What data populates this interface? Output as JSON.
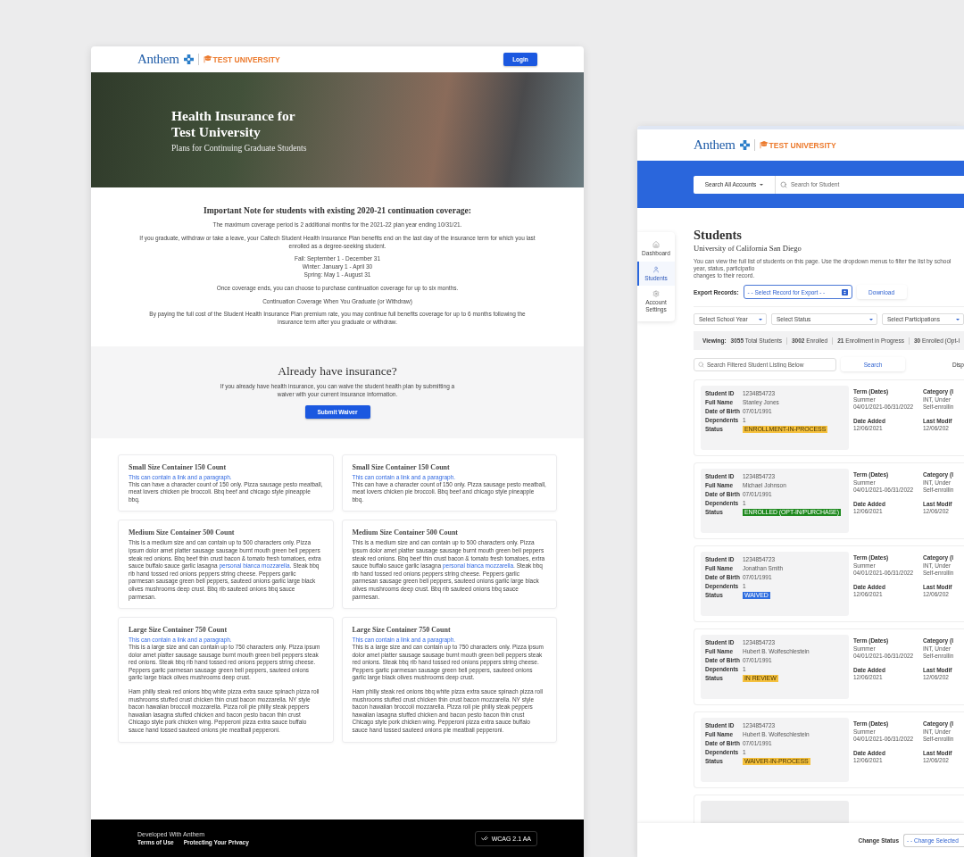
{
  "landing": {
    "header": {
      "brand": "Anthem",
      "partner": "TEST UNIVERSITY",
      "login": "Login"
    },
    "hero": {
      "title_lines": [
        "Health Insurance for",
        "Test University"
      ],
      "subtitle": "Plans for Continuing Graduate Students"
    },
    "note": {
      "heading": "Important Note for students with existing 2020-21 continuation coverage:",
      "blocks": [
        {
          "kind": "paragraph",
          "lines": [
            "The maximum coverage period is 2 additional months for the 2021-22 plan year ending 10/31/21."
          ]
        },
        {
          "kind": "paragraph",
          "lines": [
            "If you graduate, withdraw or take a leave, your Caltech Student Health Insurance Plan benefits end on the last day of the insurance term for which you last",
            "enrolled as a degree-seeking student."
          ]
        },
        {
          "kind": "paragraph",
          "lines": [
            "Fall: September 1 - December 31",
            "Winter: January 1 - April 30",
            "Spring: May 1 - August 31"
          ]
        },
        {
          "kind": "paragraph",
          "lines": [
            "Once coverage ends, you can choose to purchase continuation coverage for up to six months."
          ]
        },
        {
          "kind": "paragraph",
          "lines": [
            "Continuation Coverage When You Graduate (or Withdraw)"
          ]
        },
        {
          "kind": "paragraph",
          "lines": [
            "By paying the full cost of the Student Health Insurance Plan premium rate, you may continue full benefits coverage for up to 6 months following the",
            "insurance term after you graduate or withdraw."
          ]
        }
      ]
    },
    "waiver": {
      "heading": "Already have insurance?",
      "lines": [
        "If you already have health insurance, you can waive the student health plan by submitting a",
        "waiver with your current insurance information."
      ],
      "button": "Submit Waiver"
    },
    "cards": [
      {
        "title": "Small Size Container 150 Count",
        "link": "This can contain a link and a paragraph.",
        "paragraphs": [
          [
            {
              "kind": "text",
              "text": "This can have a character count of 150 only. Pizza sausage pesto meatball, meat lovers chicken pie broccoli. Bbq beef and chicago style pineapple bbq."
            }
          ]
        ]
      },
      {
        "title": "Small Size Container 150 Count",
        "link": "This can contain a link and a paragraph.",
        "paragraphs": [
          [
            {
              "kind": "text",
              "text": "This can have a character count of 150 only. Pizza sausage pesto meatball, meat lovers chicken pie broccoli. Bbq beef and chicago style pineapple bbq."
            }
          ]
        ]
      },
      {
        "title": "Medium Size Container 500 Count",
        "paragraphs": [
          [
            {
              "kind": "text",
              "text": "This is a medium size and can contain up to 500 characters only. Pizza ipsum dolor amet platter sausage sausage burnt mouth green bell peppers steak red onions. Bbq beef thin crust bacon & tomato fresh tomatoes, extra sauce buffalo sauce garlic lasagna "
            },
            {
              "kind": "link",
              "text": "personal bianca mozzarella"
            },
            {
              "kind": "text",
              "text": ". Steak bbq rib hand tossed red onions peppers string cheese. Peppers garlic parmesan sausage green bell peppers, sauteed onions garlic large black olives mushrooms deep crust. Bbq rib sauteed onions bbq sauce parmesan."
            }
          ]
        ]
      },
      {
        "title": "Medium Size Container 500 Count",
        "paragraphs": [
          [
            {
              "kind": "text",
              "text": "This is a medium size and can contain up to 500 characters only. Pizza ipsum dolor amet platter sausage sausage burnt mouth green bell peppers steak red onions. Bbq beef thin crust bacon & tomato fresh tomatoes, extra sauce buffalo sauce garlic lasagna "
            },
            {
              "kind": "link",
              "text": "personal bianca mozzarella"
            },
            {
              "kind": "text",
              "text": ". Steak bbq rib hand tossed red onions peppers string cheese. Peppers garlic parmesan sausage green bell peppers, sauteed onions garlic large black olives mushrooms deep crust. Bbq rib sauteed onions bbq sauce parmesan."
            }
          ]
        ]
      },
      {
        "title": "Large Size Container 750 Count",
        "link": "This can contain a link and a paragraph.",
        "paragraphs": [
          [
            {
              "kind": "text",
              "text": "This is a large size and can contain up to 750 characters only. Pizza ipsum dolor amet platter sausage sausage burnt mouth green bell peppers steak red onions. Steak bbq rib hand tossed red onions peppers string cheese. Peppers garlic parmesan sausage green bell peppers, sauteed onions garlic large black olives mushrooms deep crust."
            }
          ],
          [
            {
              "kind": "text",
              "text": "Ham philly steak red onions bbq white pizza extra sauce spinach pizza roll mushrooms stuffed crust chicken thin crust bacon mozzarella. NY style bacon hawaiian broccoli mozzarella. Pizza roll pie philly steak peppers hawaiian lasagna stuffed chicken and bacon pesto bacon thin crust Chicago style pork chicken wing. Pepperoni pizza extra sauce buffalo sauce hand tossed sauteed onions pie meatball pepperoni."
            }
          ]
        ]
      },
      {
        "title": "Large Size Container 750 Count",
        "link": "This can contain a link and a paragraph.",
        "paragraphs": [
          [
            {
              "kind": "text",
              "text": "This is a large size and can contain up to 750 characters only. Pizza ipsum dolor amet platter sausage sausage burnt mouth green bell peppers steak red onions. Steak bbq rib hand tossed red onions peppers string cheese. Peppers garlic parmesan sausage green bell peppers, sauteed onions garlic large black olives mushrooms deep crust."
            }
          ],
          [
            {
              "kind": "text",
              "text": "Ham philly steak red onions bbq white pizza extra sauce spinach pizza roll mushrooms stuffed crust chicken thin crust bacon mozzarella. NY style bacon hawaiian broccoli mozzarella. Pizza roll pie philly steak peppers hawaiian lasagna stuffed chicken and bacon pesto bacon thin crust Chicago style pork chicken wing. Pepperoni pizza extra sauce buffalo sauce hand tossed sauteed onions pie meatball pepperoni."
            }
          ]
        ]
      }
    ],
    "footer": {
      "credit": "Developed With Anthem",
      "links": [
        "Terms of Use",
        "Protecting Your Privacy"
      ],
      "badge": "WCAG 2.1 AA"
    }
  },
  "portal": {
    "header": {
      "brand": "Anthem",
      "partner": "TEST UNIVERSITY"
    },
    "search": {
      "scope": "Search All Accounts",
      "placeholder": "Search for Student"
    },
    "sidebar": [
      {
        "label": "Dashboard",
        "kind": "home",
        "selected": false
      },
      {
        "label": "Students",
        "kind": "person",
        "selected": true
      },
      {
        "label": "Account Settings",
        "kind": "gear",
        "selected": false
      }
    ],
    "title": "Students",
    "subtitle": "University of California San Diego",
    "description": [
      "You can view the full list of students on this page. Use the dropdown menus to filter the list by school year, status, participatio",
      "changes to their record."
    ],
    "export": {
      "label": "Export Records:",
      "select": "- - Select Record for Export - -",
      "button": "Download"
    },
    "filters": [
      "Select School Year",
      "Select Status",
      "Select Participations"
    ],
    "stats": {
      "label": "Viewing:",
      "items": [
        {
          "count": "3055",
          "label": "Total Students"
        },
        {
          "count": "3002",
          "label": "Enrolled"
        },
        {
          "count": "21",
          "label": "Enrollment in Progress"
        },
        {
          "count": "30",
          "label": "Enrolled (Opt-I"
        }
      ]
    },
    "listing_search": {
      "placeholder": "Search Filtered Student Listing Below",
      "button": "Search",
      "cut_label": "Disp"
    },
    "records": [
      {
        "details": [
          {
            "label": "Student ID",
            "value": "1234854723"
          },
          {
            "label": "Full Name",
            "value": "Stanley Jones"
          },
          {
            "label": "Date of Birth",
            "value": "07/01/1991"
          },
          {
            "label": "Dependents",
            "value": "1"
          }
        ],
        "status": {
          "label": "Status",
          "value": "ENROLLMENT-IN-PROCESS",
          "color": "#f5c13e"
        },
        "term": {
          "label": "Term (Dates)",
          "season": "Summer",
          "dates": "04/01/2021-06/31/2022"
        },
        "added": {
          "label": "Date Added",
          "value": "12/06/2021"
        },
        "category": {
          "label": "Category (I",
          "lines": [
            "INT, Under",
            "Self-enrollin"
          ]
        },
        "modified": {
          "label": "Last Modif",
          "value": "12/06/202"
        }
      },
      {
        "details": [
          {
            "label": "Student ID",
            "value": "1234854723"
          },
          {
            "label": "Full Name",
            "value": "Michael Johnson"
          },
          {
            "label": "Date of Birth",
            "value": "07/01/1991"
          },
          {
            "label": "Dependents",
            "value": "1"
          }
        ],
        "status": {
          "label": "Status",
          "value": "ENROLLED (OPT-IN/PURCHASE)",
          "color": "#1f8a1f"
        },
        "term": {
          "label": "Term (Dates)",
          "season": "Summer",
          "dates": "04/01/2021-06/31/2022"
        },
        "added": {
          "label": "Date Added",
          "value": "12/06/2021"
        },
        "category": {
          "label": "Category (I",
          "lines": [
            "INT, Under",
            "Self-enrollin"
          ]
        },
        "modified": {
          "label": "Last Modif",
          "value": "12/06/202"
        }
      },
      {
        "details": [
          {
            "label": "Student ID",
            "value": "1234854723"
          },
          {
            "label": "Full Name",
            "value": "Jonathan Smith"
          },
          {
            "label": "Date of Birth",
            "value": "07/01/1991"
          },
          {
            "label": "Dependents",
            "value": "1"
          }
        ],
        "status": {
          "label": "Status",
          "value": "WAIVED",
          "color": "#2f6ee0"
        },
        "term": {
          "label": "Term (Dates)",
          "season": "Summer",
          "dates": "04/01/2021-06/31/2022"
        },
        "added": {
          "label": "Date Added",
          "value": "12/06/2021"
        },
        "category": {
          "label": "Category (I",
          "lines": [
            "INT, Under",
            "Self-enrollin"
          ]
        },
        "modified": {
          "label": "Last Modif",
          "value": "12/06/202"
        }
      },
      {
        "details": [
          {
            "label": "Student ID",
            "value": "1234854723"
          },
          {
            "label": "Full Name",
            "value": "Hubert B. Wolfeschlestein"
          },
          {
            "label": "Date of Birth",
            "value": "07/01/1991"
          },
          {
            "label": "Dependents",
            "value": "1"
          }
        ],
        "status": {
          "label": "Status",
          "value": "IN REVIEW",
          "color": "#f5c13e"
        },
        "term": {
          "label": "Term (Dates)",
          "season": "Summer",
          "dates": "04/01/2021-06/31/2022"
        },
        "added": {
          "label": "Date Added",
          "value": "12/06/2021"
        },
        "category": {
          "label": "Category (I",
          "lines": [
            "INT, Under",
            "Self-enrollin"
          ]
        },
        "modified": {
          "label": "Last Modif",
          "value": "12/06/202"
        }
      },
      {
        "details": [
          {
            "label": "Student ID",
            "value": "1234854723"
          },
          {
            "label": "Full Name",
            "value": "Hubert B. Wolfeschlestein"
          },
          {
            "label": "Date of Birth",
            "value": "07/01/1991"
          },
          {
            "label": "Dependents",
            "value": "1"
          }
        ],
        "status": {
          "label": "Status",
          "value": "WAIVER-IN-PROCESS",
          "color": "#f5c13e"
        },
        "term": {
          "label": "Term (Dates)",
          "season": "Summer",
          "dates": "04/01/2021-06/31/2022"
        },
        "added": {
          "label": "Date Added",
          "value": "12/06/2021"
        },
        "category": {
          "label": "Category (I",
          "lines": [
            "INT, Under",
            "Self-enrollin"
          ]
        },
        "modified": {
          "label": "Last Modif",
          "value": "12/06/202"
        }
      }
    ],
    "bottom_bar": {
      "label": "Change Status",
      "select": "- - Change Selected"
    }
  }
}
